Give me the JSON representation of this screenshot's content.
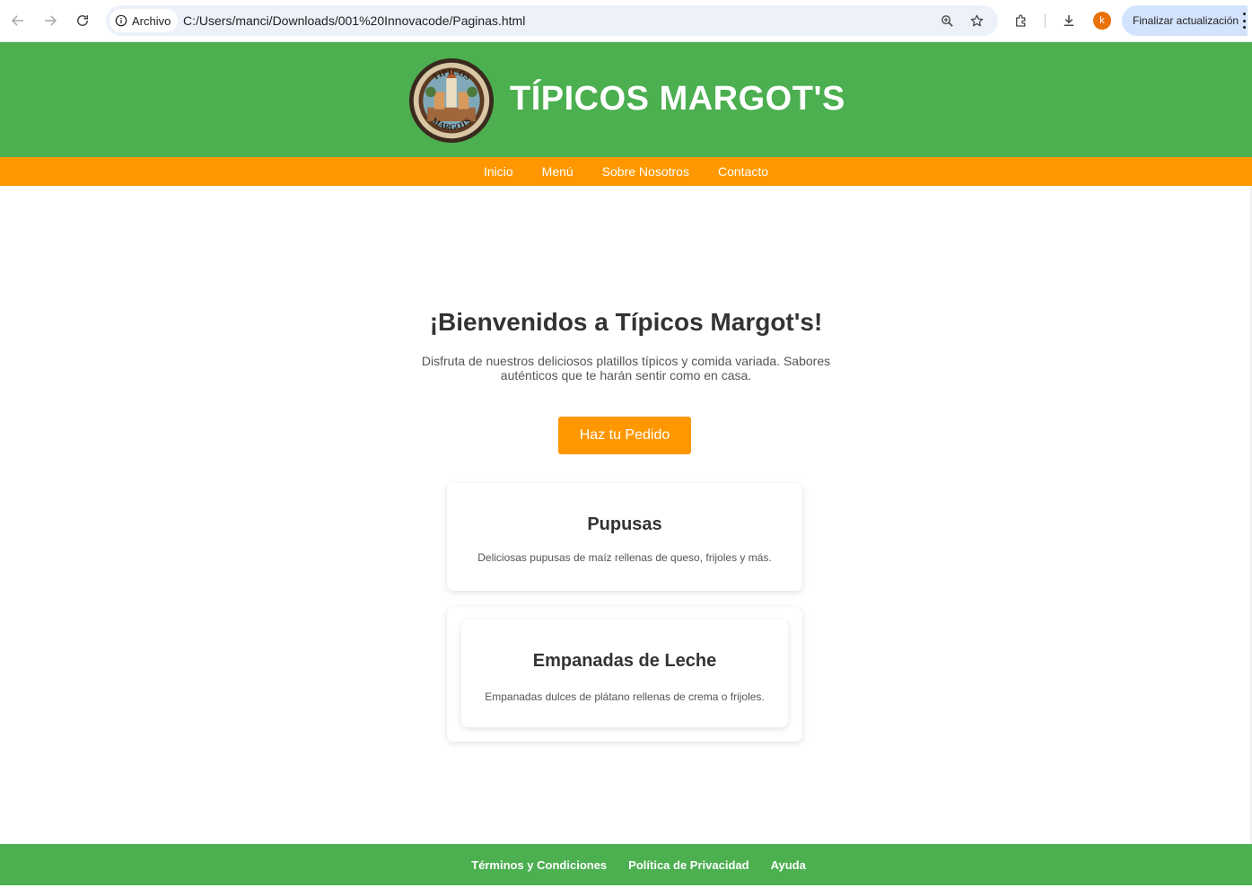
{
  "browser": {
    "site_chip_label": "Archivo",
    "url": "C:/Users/manci/Downloads/001%20Innovacode/Paginas.html",
    "avatar_letter": "k",
    "update_button": "Finalizar actualización"
  },
  "header": {
    "logo_text_top": "TIPICOS",
    "logo_text_bottom": "MARGOTS",
    "title": "TÍPICOS MARGOT'S"
  },
  "nav": {
    "items": [
      "Inicio",
      "Menú",
      "Sobre Nosotros",
      "Contacto"
    ]
  },
  "hero": {
    "title": "¡Bienvenidos a Típicos Margot's!",
    "text": "Disfruta de nuestros deliciosos platillos típicos y comida variada. Sabores auténticos que te harán sentir como en casa.",
    "button": "Haz tu Pedido"
  },
  "cards": [
    {
      "title": "Pupusas",
      "text": "Deliciosas pupusas de maíz rellenas de queso, frijoles y más."
    },
    {
      "title": "Empanadas de Leche",
      "text": "Empanadas dulces de plátano rellenas de crema o frijoles."
    }
  ],
  "footer": {
    "links": [
      "Términos y Condiciones",
      "Política de Privacidad",
      "Ayuda"
    ]
  },
  "colors": {
    "header_green": "#4caf50",
    "accent_orange": "#ff9800"
  }
}
